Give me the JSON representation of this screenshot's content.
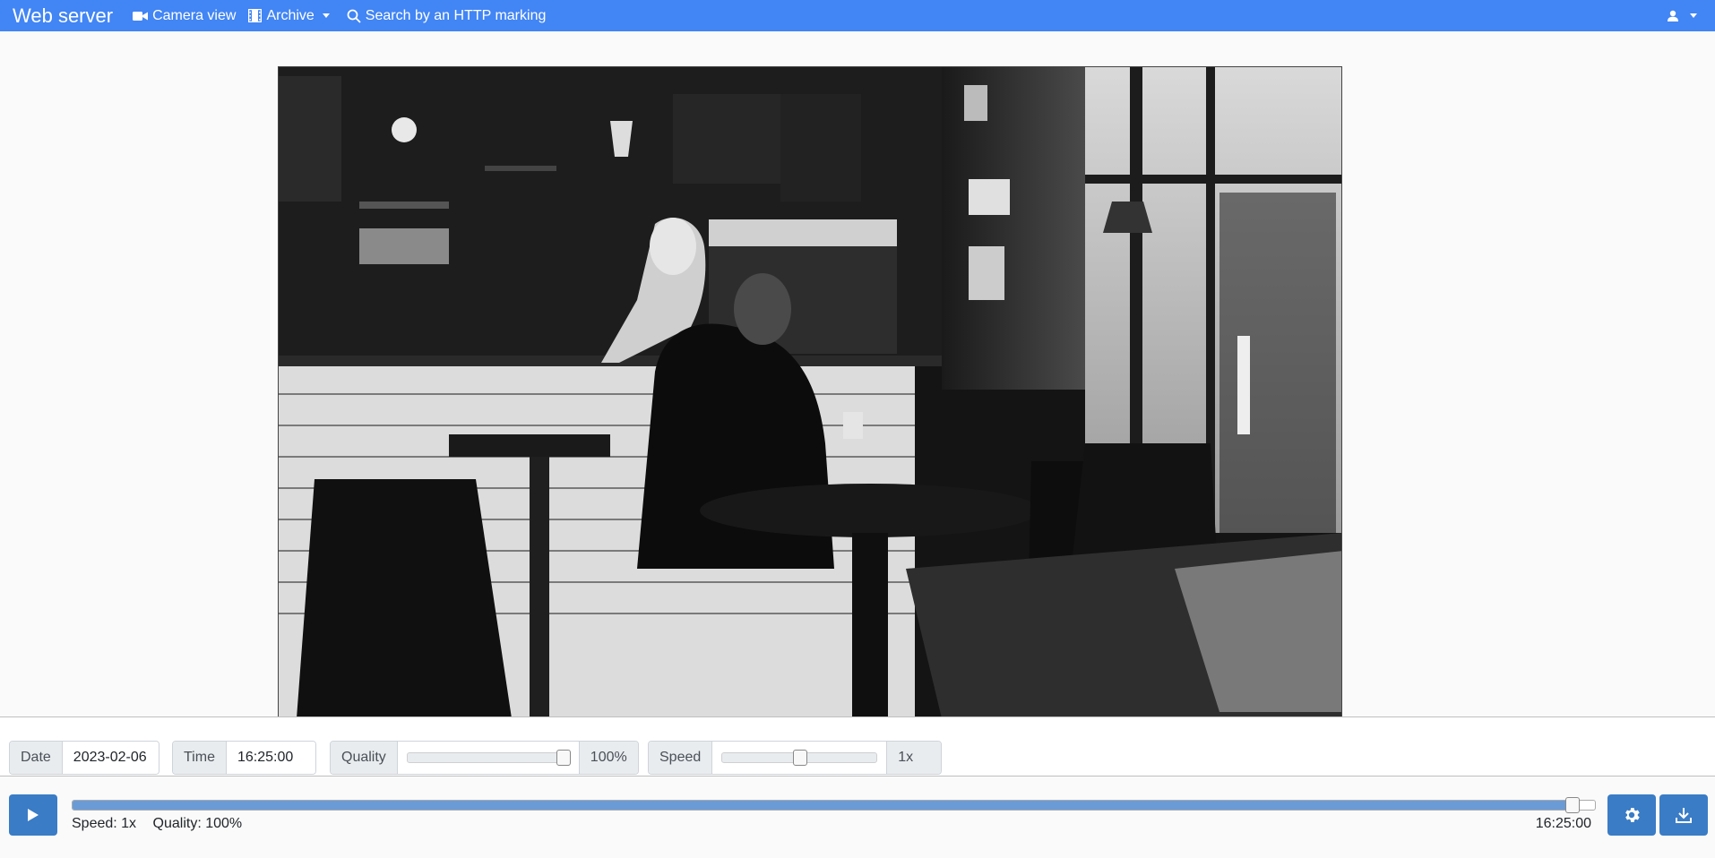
{
  "navbar": {
    "brand": "Web server",
    "items": [
      {
        "label": "Camera view",
        "icon": "video-camera-icon"
      },
      {
        "label": "Archive",
        "icon": "film-icon",
        "dropdown": true
      },
      {
        "label": "Search by an HTTP marking",
        "icon": "search-icon"
      }
    ],
    "user_icon": "user-icon"
  },
  "controls": {
    "date_label": "Date",
    "date_value": "2023-02-06",
    "time_label": "Time",
    "time_value": "16:25:00",
    "quality_label": "Quality",
    "quality_value": "100%",
    "quality_level": 1.0,
    "speed_label": "Speed",
    "speed_value": "1x",
    "speed_level": 0.5
  },
  "playback": {
    "progress": 0.99,
    "speed_text": "Speed: 1x",
    "quality_text": "Quality: 100%",
    "current_time": "16:25:00"
  },
  "colors": {
    "navbar": "#4285f4",
    "button": "#3a7cc6",
    "timeline_fill": "#6b9bd6"
  }
}
